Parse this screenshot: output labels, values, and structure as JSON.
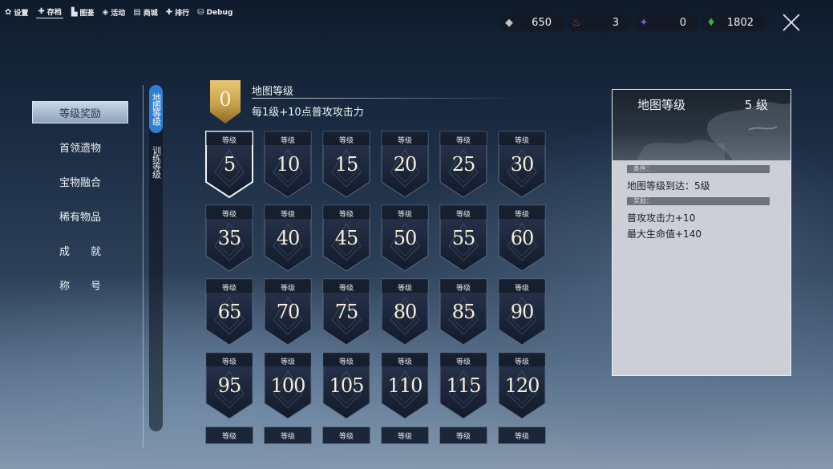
{
  "top_menu": [
    {
      "icon": "gear-icon",
      "glyph": "✿",
      "label": "设置"
    },
    {
      "icon": "save-icon",
      "glyph": "✚",
      "label": "存档"
    },
    {
      "icon": "book-icon",
      "glyph": "▙",
      "label": "图鉴"
    },
    {
      "icon": "event-icon",
      "glyph": "◈",
      "label": "活动"
    },
    {
      "icon": "shop-icon",
      "glyph": "▤",
      "label": "商城"
    },
    {
      "icon": "ranking-icon",
      "glyph": "✚",
      "label": "排行"
    },
    {
      "icon": "debug-icon",
      "glyph": "⛁",
      "label": "Debug"
    }
  ],
  "currencies": [
    {
      "name": "silver-currency-icon",
      "value": "650",
      "color": "#b8c4cc",
      "glyph": "◆"
    },
    {
      "name": "fire-currency-icon",
      "value": "3",
      "color": "#e0403a",
      "glyph": "♨"
    },
    {
      "name": "purple-gem-currency-icon",
      "value": "0",
      "color": "#8a4fd8",
      "glyph": "✦"
    },
    {
      "name": "green-crystal-currency-icon",
      "value": "1802",
      "color": "#3fae4a",
      "glyph": "♦"
    }
  ],
  "left_nav": [
    "等级奖励",
    "首领遗物",
    "宝物融合",
    "稀有物品",
    "成　　就",
    "称　　号"
  ],
  "vertical_tabs": [
    "地图等级",
    "训练等级"
  ],
  "header": {
    "current_level": "0",
    "title": "地图等级",
    "description": "每1级+10点普攻攻击力"
  },
  "badge_label": "等级",
  "badges": [
    "5",
    "10",
    "15",
    "20",
    "25",
    "30",
    "35",
    "40",
    "45",
    "50",
    "55",
    "60",
    "65",
    "70",
    "75",
    "80",
    "85",
    "90",
    "95",
    "100",
    "105",
    "110",
    "115",
    "120"
  ],
  "selected_badge": "5",
  "detail": {
    "title": "地图等级",
    "level": "5 级",
    "condition_label": "条件：",
    "condition": "地图等级到达：5级",
    "reward_label": "奖励：",
    "rewards": [
      "普攻攻击力+10",
      "最大生命值+140"
    ]
  },
  "colors": {
    "accent_blue": "#2f7fd0",
    "gold": "#c9a24a",
    "badge_dark": "#1b2638"
  }
}
